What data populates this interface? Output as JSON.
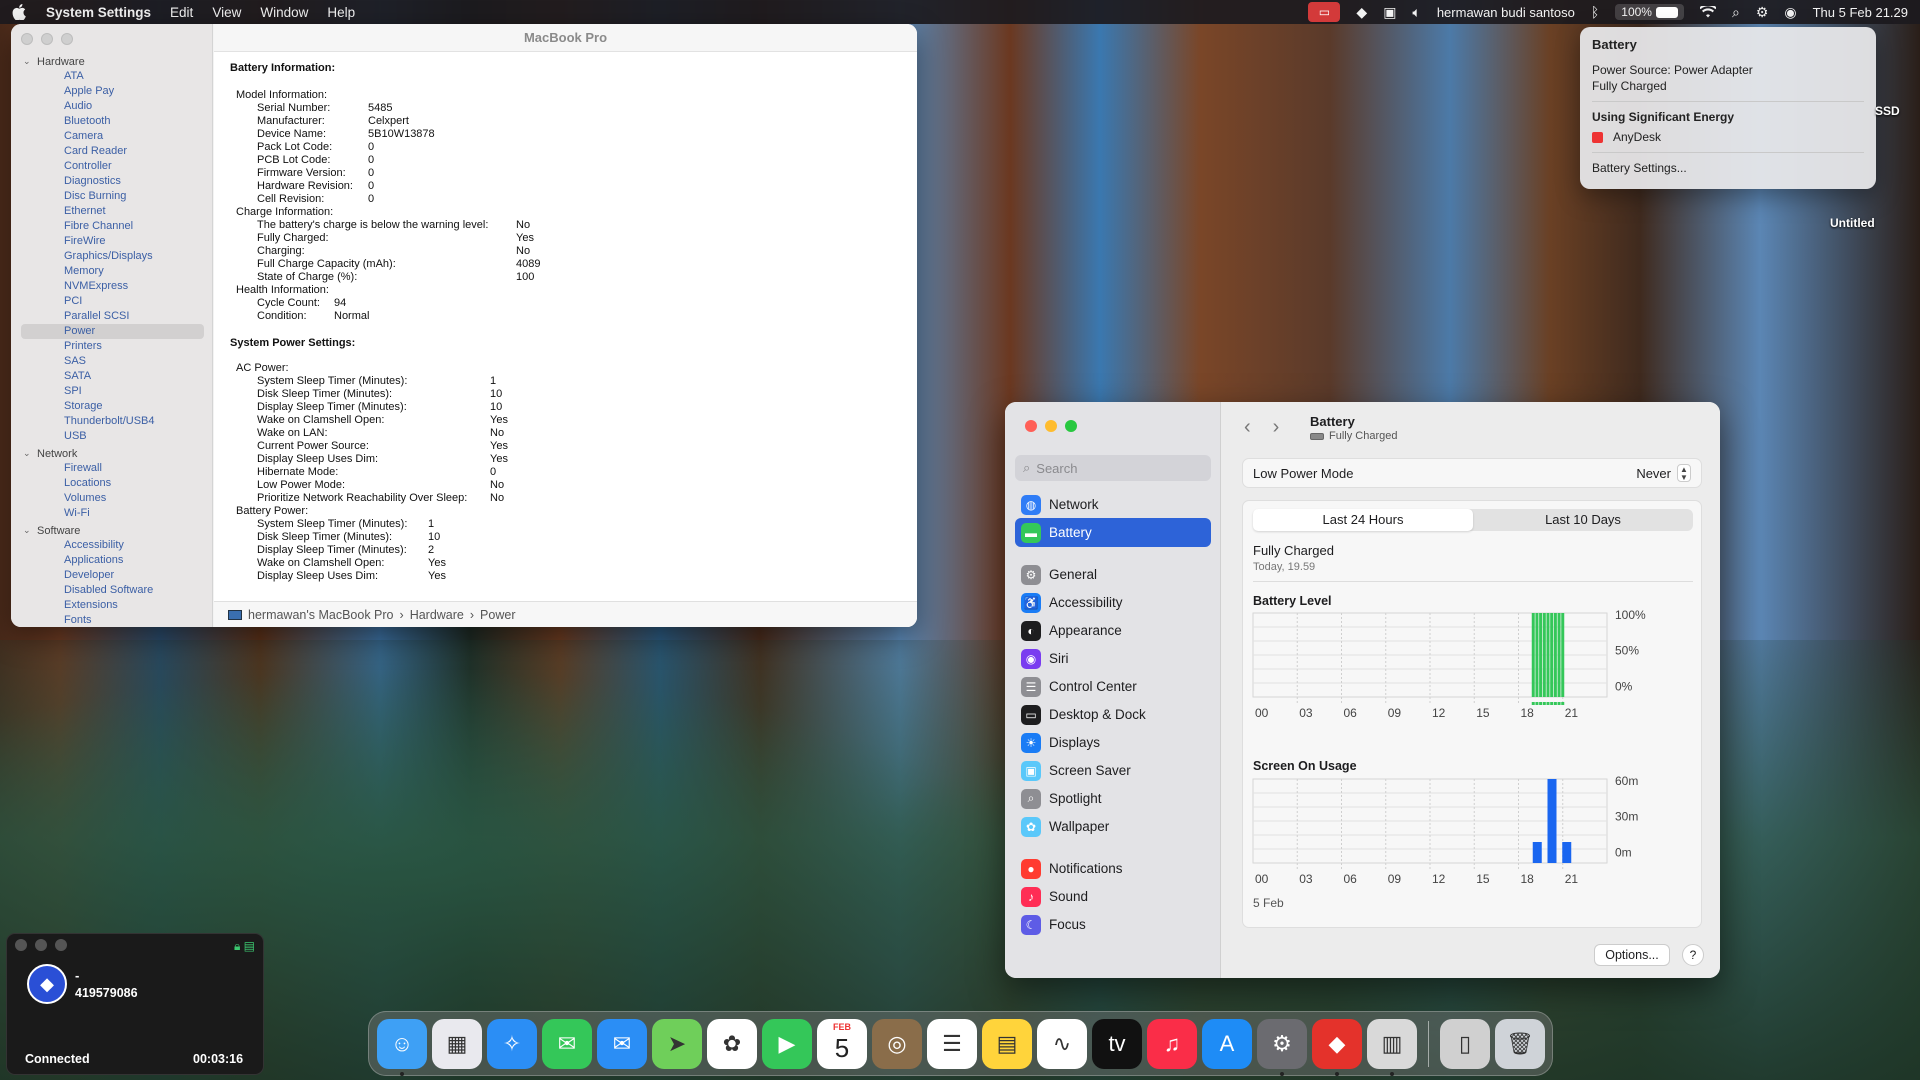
{
  "menubar": {
    "app": "System Settings",
    "menus": [
      "Edit",
      "View",
      "Window",
      "Help"
    ],
    "user": "hermawan budi santoso",
    "battery_pct": "100%",
    "datetime": "Thu 5 Feb  21.29"
  },
  "info_window": {
    "title": "MacBook Pro",
    "sidebar": {
      "hardware_label": "Hardware",
      "hardware": [
        "ATA",
        "Apple Pay",
        "Audio",
        "Bluetooth",
        "Camera",
        "Card Reader",
        "Controller",
        "Diagnostics",
        "Disc Burning",
        "Ethernet",
        "Fibre Channel",
        "FireWire",
        "Graphics/Displays",
        "Memory",
        "NVMExpress",
        "PCI",
        "Parallel SCSI",
        "Power",
        "Printers",
        "SAS",
        "SATA",
        "SPI",
        "Storage",
        "Thunderbolt/USB4",
        "USB"
      ],
      "selected": "Power",
      "network_label": "Network",
      "network": [
        "Firewall",
        "Locations",
        "Volumes",
        "Wi-Fi"
      ],
      "software_label": "Software",
      "software": [
        "Accessibility",
        "Applications",
        "Developer",
        "Disabled Software",
        "Extensions",
        "Fonts"
      ]
    },
    "battery_info_heading": "Battery Information:",
    "model_info_label": "Model Information:",
    "model_info": [
      [
        "Serial Number:",
        "5485"
      ],
      [
        "Manufacturer:",
        "Celxpert"
      ],
      [
        "Device Name:",
        "5B10W13878"
      ],
      [
        "Pack Lot Code:",
        "0"
      ],
      [
        "PCB Lot Code:",
        "0"
      ],
      [
        "Firmware Version:",
        "0"
      ],
      [
        "Hardware Revision:",
        "0"
      ],
      [
        "Cell Revision:",
        "0"
      ]
    ],
    "charge_info_label": "Charge Information:",
    "charge_info": [
      [
        "The battery's charge is below the warning level:",
        "No"
      ],
      [
        "Fully Charged:",
        "Yes"
      ],
      [
        "Charging:",
        "No"
      ],
      [
        "Full Charge Capacity (mAh):",
        "4089"
      ],
      [
        "State of Charge (%):",
        "100"
      ]
    ],
    "health_info_label": "Health Information:",
    "health_info": [
      [
        "Cycle Count:",
        "94"
      ],
      [
        "Condition:",
        "Normal"
      ]
    ],
    "system_power_heading": "System Power Settings:",
    "ac_power_label": "AC Power:",
    "ac_power": [
      [
        "System Sleep Timer (Minutes):",
        "1"
      ],
      [
        "Disk Sleep Timer (Minutes):",
        "10"
      ],
      [
        "Display Sleep Timer (Minutes):",
        "10"
      ],
      [
        "Wake on Clamshell Open:",
        "Yes"
      ],
      [
        "Wake on LAN:",
        "No"
      ],
      [
        "Current Power Source:",
        "Yes"
      ],
      [
        "Display Sleep Uses Dim:",
        "Yes"
      ],
      [
        "Hibernate Mode:",
        "0"
      ],
      [
        "Low Power Mode:",
        "No"
      ],
      [
        "Prioritize Network Reachability Over Sleep:",
        "No"
      ]
    ],
    "battery_power_label": "Battery Power:",
    "battery_power": [
      [
        "System Sleep Timer (Minutes):",
        "1"
      ],
      [
        "Disk Sleep Timer (Minutes):",
        "10"
      ],
      [
        "Display Sleep Timer (Minutes):",
        "2"
      ],
      [
        "Wake on Clamshell Open:",
        "Yes"
      ],
      [
        "Display Sleep Uses Dim:",
        "Yes"
      ]
    ],
    "path": [
      "hermawan's MacBook Pro",
      "Hardware",
      "Power"
    ]
  },
  "popover": {
    "title": "Battery",
    "source": "Power Source: Power Adapter",
    "status": "Fully Charged",
    "energy_heading": "Using Significant Energy",
    "app": "AnyDesk",
    "settings": "Battery Settings..."
  },
  "desktop": {
    "ssd_label": "SSD",
    "untitled_label": "Untitled"
  },
  "settings": {
    "search_placeholder": "Search",
    "sidebar": [
      {
        "label": "Network",
        "icon": "globe-icon",
        "color": "#2f7cf6"
      },
      {
        "label": "Battery",
        "icon": "battery-icon",
        "color": "#34c759",
        "selected": true
      },
      {
        "label": "General",
        "icon": "gear-icon",
        "color": "#8e8e93"
      },
      {
        "label": "Accessibility",
        "icon": "accessibility-icon",
        "color": "#1a7cf5"
      },
      {
        "label": "Appearance",
        "icon": "appearance-icon",
        "color": "#1d1d1f"
      },
      {
        "label": "Siri",
        "icon": "siri-icon",
        "color": "#7a3cf0"
      },
      {
        "label": "Control Center",
        "icon": "control-center-icon",
        "color": "#8e8e93"
      },
      {
        "label": "Desktop & Dock",
        "icon": "dock-icon",
        "color": "#1d1d1f"
      },
      {
        "label": "Displays",
        "icon": "displays-icon",
        "color": "#1a7cf5"
      },
      {
        "label": "Screen Saver",
        "icon": "screen-saver-icon",
        "color": "#5ac8fa"
      },
      {
        "label": "Spotlight",
        "icon": "spotlight-icon",
        "color": "#8e8e93"
      },
      {
        "label": "Wallpaper",
        "icon": "wallpaper-icon",
        "color": "#5ac8fa"
      },
      {
        "label": "Notifications",
        "icon": "notifications-icon",
        "color": "#ff3b30"
      },
      {
        "label": "Sound",
        "icon": "sound-icon",
        "color": "#ff2d55"
      },
      {
        "label": "Focus",
        "icon": "focus-icon",
        "color": "#5e5ce6"
      }
    ],
    "title": "Battery",
    "subtitle": "Fully Charged",
    "low_power_label": "Low Power Mode",
    "low_power_value": "Never",
    "tabs": [
      "Last 24 Hours",
      "Last 10 Days"
    ],
    "status": "Fully Charged",
    "status_time": "Today, 19.59",
    "battery_chart_title": "Battery Level",
    "screen_chart_title": "Screen On Usage",
    "date_label": "5 Feb",
    "options": "Options...",
    "help": "?"
  },
  "chart_data": [
    {
      "type": "bar",
      "title": "Battery Level",
      "x": [
        "00",
        "03",
        "06",
        "09",
        "12",
        "15",
        "18",
        "21"
      ],
      "y_ticks": [
        "100%",
        "50%",
        "0%"
      ],
      "ylim": [
        0,
        100
      ],
      "bars_hours": [
        19.0,
        19.25,
        19.5,
        19.75,
        20.0,
        20.25,
        20.5,
        20.75,
        21.0
      ],
      "values": [
        100,
        100,
        100,
        100,
        100,
        100,
        100,
        100,
        100
      ],
      "color": "#34c759"
    },
    {
      "type": "bar",
      "title": "Screen On Usage",
      "x": [
        "00",
        "03",
        "06",
        "09",
        "12",
        "15",
        "18",
        "21"
      ],
      "y_ticks": [
        "60m",
        "30m",
        "0m"
      ],
      "ylim": [
        0,
        60
      ],
      "bars_hours": [
        19,
        20,
        21
      ],
      "values": [
        15,
        60,
        15
      ],
      "color": "#1a66f0"
    }
  ],
  "anydesk": {
    "name": "-",
    "id": "419579086",
    "status": "Connected",
    "timer": "00:03:16"
  },
  "dock": [
    {
      "name": "Finder",
      "icon": "finder-icon",
      "color": "#3ea0f5",
      "running": true
    },
    {
      "name": "Launchpad",
      "icon": "launchpad-icon",
      "color": "#e9e9ee"
    },
    {
      "name": "Safari",
      "icon": "safari-icon",
      "color": "#2b8ef5"
    },
    {
      "name": "Messages",
      "icon": "messages-icon",
      "color": "#34c759"
    },
    {
      "name": "Mail",
      "icon": "mail-icon",
      "color": "#2b8ef5"
    },
    {
      "name": "Maps",
      "icon": "maps-icon",
      "color": "#6fcf5a"
    },
    {
      "name": "Photos",
      "icon": "photos-icon",
      "color": "#ffffff"
    },
    {
      "name": "FaceTime",
      "icon": "facetime-icon",
      "color": "#34c759"
    },
    {
      "name": "Calendar",
      "icon": "calendar-icon",
      "color": "#ffffff",
      "month": "FEB",
      "day": "5"
    },
    {
      "name": "Contacts",
      "icon": "contacts-icon",
      "color": "#8a6d4a"
    },
    {
      "name": "Reminders",
      "icon": "reminders-icon",
      "color": "#ffffff"
    },
    {
      "name": "Notes",
      "icon": "notes-icon",
      "color": "#ffd43b"
    },
    {
      "name": "Freeform",
      "icon": "freeform-icon",
      "color": "#ffffff"
    },
    {
      "name": "TV",
      "icon": "tv-icon",
      "color": "#111111"
    },
    {
      "name": "Music",
      "icon": "music-icon",
      "color": "#fa2d48"
    },
    {
      "name": "App Store",
      "icon": "app-store-icon",
      "color": "#1e8cf6"
    },
    {
      "name": "System Settings",
      "icon": "settings-icon",
      "color": "#6b6b70",
      "running": true
    },
    {
      "name": "AnyDesk",
      "icon": "anydesk-icon",
      "color": "#e4322b",
      "running": true
    },
    {
      "name": "System Information",
      "icon": "system-info-icon",
      "color": "#d9d9d9",
      "running": true
    },
    {
      "name": "Documents",
      "icon": "documents-icon",
      "color": "#d0d0d0"
    },
    {
      "name": "Trash",
      "icon": "trash-icon",
      "color": "#cfd3d8"
    }
  ]
}
